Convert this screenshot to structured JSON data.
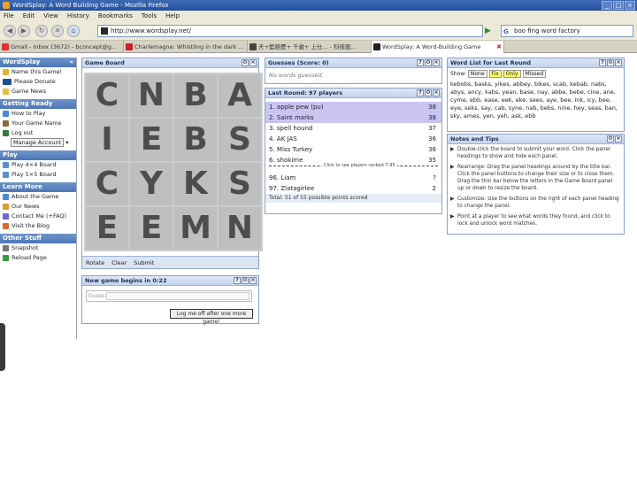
{
  "window": {
    "title": "WordSplay: A Word Building Game - Mozilla Firefox",
    "controls": [
      "_",
      "□",
      "×"
    ]
  },
  "menu": [
    "File",
    "Edit",
    "View",
    "History",
    "Bookmarks",
    "Tools",
    "Help"
  ],
  "nav": {
    "url": "http://www.wordsplay.net/",
    "search": "boo fing word factory"
  },
  "tabs": [
    {
      "label": "Gmail - Inbox (3672) - bconcept@g...",
      "color": "#d33"
    },
    {
      "label": "Charlemagne: Whistling in the dark ...",
      "color": "#c22"
    },
    {
      "label": "天+藍經歷+ 千歲+ 上仕... - 科技股...",
      "color": "#444"
    },
    {
      "label": "WordSplay: A Word-Building Game",
      "color": "#222"
    }
  ],
  "sidebar": {
    "brand": "WordSplay",
    "top_items": [
      "Name this Game!",
      "Please Donate",
      "Game News"
    ],
    "getting_ready": {
      "title": "Getting Ready",
      "items": [
        "How to Play",
        "Your Game Name",
        "Log out"
      ],
      "manage": "Manage Account"
    },
    "play": {
      "title": "Play",
      "items": [
        "Play 4×4 Board",
        "Play 5×5 Board"
      ]
    },
    "learn_more": {
      "title": "Learn More",
      "items": [
        "About the Game",
        "Our News",
        "Contact Me (+FAQ)",
        "Visit the Blog"
      ]
    },
    "other": {
      "title": "Other Stuff",
      "items": [
        "Snapshot",
        "Reload Page"
      ]
    },
    "collapse": "«"
  },
  "board": {
    "title": "Game Board",
    "tiles": [
      "C",
      "N",
      "B",
      "A",
      "I",
      "E",
      "B",
      "S",
      "C",
      "Y",
      "K",
      "S",
      "E",
      "E",
      "M",
      "N"
    ],
    "actions": [
      "Rotate",
      "Clear",
      "Submit"
    ]
  },
  "guesses": {
    "title": "Guesses (Score: 0)",
    "empty": "No words guessed."
  },
  "lastround": {
    "title": "Last Round: 97 players",
    "rows": [
      {
        "name": "1. apple pew (pu)",
        "score": "38"
      },
      {
        "name": "2. Saint marks",
        "score": "38"
      },
      {
        "name": "3. spell hound",
        "score": "37"
      },
      {
        "name": "4. AK JAS",
        "score": "36"
      },
      {
        "name": "5. Miss Turkey",
        "score": "36"
      },
      {
        "name": "6. shokime",
        "score": "35"
      }
    ],
    "tip": "Click to see players ranked 7-95",
    "bottom_rows": [
      {
        "name": "96. Liam",
        "score": "?"
      },
      {
        "name": "97. Zlatagirlee",
        "score": "2"
      }
    ],
    "total": "Total: 51 of 55 possible points scored"
  },
  "wordlist": {
    "title": "Word List for Last Round",
    "show_label": "Show:",
    "options": [
      "None",
      "Fix",
      "Only",
      "Missed"
    ],
    "words": "kebobs, basks, yikes, abbey, bikes, scab, kebab, nabs, abys, ancy, kabs, yean, base, nay, abbe, bebe, cine, ane, cyme, ebb, ease, eek, eke, sees, aye, bee, ink, icy, bee, eye, seks, say, cab, syne, nab, bebs, nine, hey, seas, ban, sky, ames, yen, yeh, ask, ebb"
  },
  "notes": {
    "title": "Notes and Tips",
    "items": [
      "Double-click the board to submit your word. Click the panel headings to show and hide each panel.",
      "Rearrange: Drag the panel headings around by the title bar. Click the panel buttons to change their size or to close them. Drag the thin bar below the letters in the Game Board panel up or down to resize the board.",
      "Customize: Use the buttons on the right of each panel heading to change the panel.",
      "Point at a player to see what words they found, and click to lock and unlock word matches."
    ]
  },
  "newgame": {
    "title": "New game begins in 0:22",
    "input_label": "Guess:",
    "button": "Log me off after one more game!"
  },
  "panel_buttons": [
    "?",
    "+",
    "×"
  ],
  "colors": {
    "sidebar_head": "#4c76b6",
    "highlight": "#c9c4f0",
    "tile": "#bfbfbf"
  }
}
